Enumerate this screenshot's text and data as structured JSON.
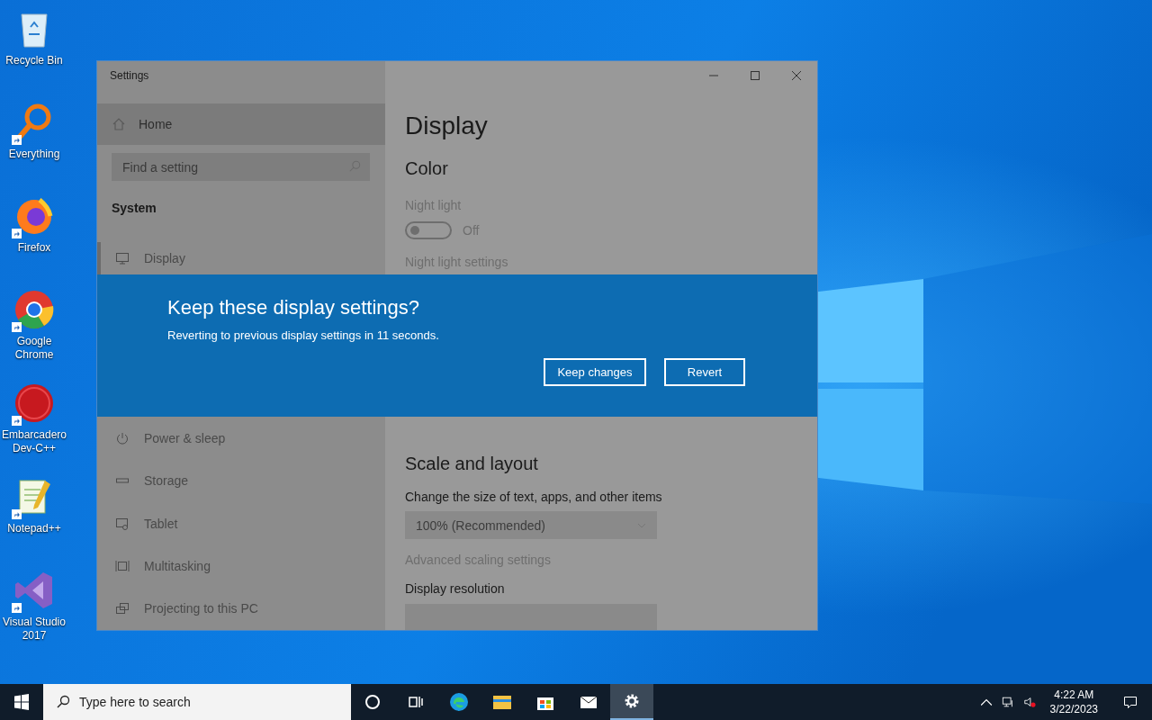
{
  "desktop_icons": [
    {
      "label": "Recycle Bin",
      "kind": "recycle"
    },
    {
      "label": "Everything",
      "kind": "magnifier"
    },
    {
      "label": "Firefox",
      "kind": "firefox"
    },
    {
      "label": "Google Chrome",
      "kind": "chrome"
    },
    {
      "label": "Embarcadero Dev-C++",
      "kind": "devcpp"
    },
    {
      "label": "Notepad++",
      "kind": "notepad"
    },
    {
      "label": "Visual Studio 2017",
      "kind": "vs"
    }
  ],
  "settings_window": {
    "title": "Settings",
    "sidebar": {
      "home": "Home",
      "search": {
        "placeholder": "Find a setting"
      },
      "section": "System",
      "upper_items": [
        {
          "label": "Display",
          "kind": "monitor",
          "selected": true
        }
      ],
      "lower_items": [
        {
          "label": "Power & sleep",
          "kind": "power",
          "selected": false
        },
        {
          "label": "Storage",
          "kind": "storage",
          "selected": false
        },
        {
          "label": "Tablet",
          "kind": "tablet",
          "selected": false
        },
        {
          "label": "Multitasking",
          "kind": "multitask",
          "selected": false
        },
        {
          "label": "Projecting to this PC",
          "kind": "project",
          "selected": false
        }
      ]
    },
    "content": {
      "heading": "Display",
      "color_section": "Color",
      "night_light_label": "Night light",
      "night_light": {
        "on": false,
        "state_text": "Off"
      },
      "night_light_link": "Night light settings",
      "scale_section": "Scale and layout",
      "scale_label": "Change the size of text, apps, and other items",
      "scale_value": "100% (Recommended)",
      "advanced_link": "Advanced scaling settings",
      "resolution_label": "Display resolution"
    }
  },
  "dialog": {
    "title": "Keep these display settings?",
    "message": "Reverting to previous display settings in 11 seconds.",
    "buttons": [
      "Keep changes",
      "Revert"
    ]
  },
  "taskbar": {
    "search_placeholder": "Type here to search",
    "apps": [
      {
        "kind": "cortana",
        "active": false
      },
      {
        "kind": "taskview",
        "active": false
      },
      {
        "kind": "edge",
        "active": false
      },
      {
        "kind": "explorer",
        "active": false
      },
      {
        "kind": "store",
        "active": false
      },
      {
        "kind": "mail",
        "active": false
      },
      {
        "kind": "settings",
        "active": true
      }
    ],
    "time": "4:22 AM",
    "date": "3/22/2023"
  }
}
